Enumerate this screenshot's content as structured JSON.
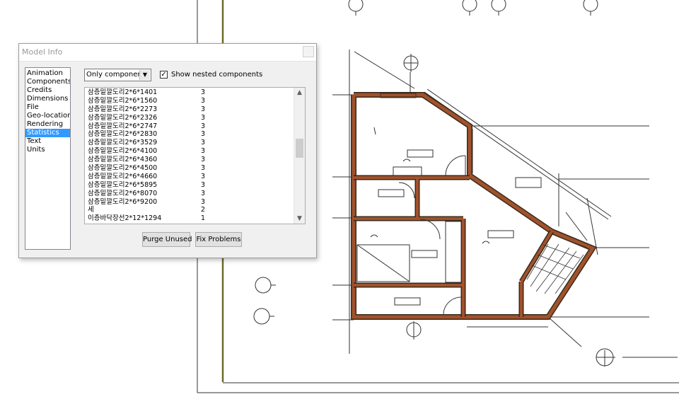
{
  "dialog": {
    "title": "Model Info",
    "close_label": ""
  },
  "categories": [
    {
      "label": "Animation",
      "selected": false
    },
    {
      "label": "Components",
      "selected": false
    },
    {
      "label": "Credits",
      "selected": false
    },
    {
      "label": "Dimensions",
      "selected": false
    },
    {
      "label": "File",
      "selected": false
    },
    {
      "label": "Geo-location",
      "selected": false
    },
    {
      "label": "Rendering",
      "selected": false
    },
    {
      "label": "Statistics",
      "selected": true
    },
    {
      "label": "Text",
      "selected": false
    },
    {
      "label": "Units",
      "selected": false
    }
  ],
  "filter": {
    "value": "Only components",
    "arrow": "▼"
  },
  "nested": {
    "checked": true,
    "check_mark": "✓",
    "label": "Show nested components"
  },
  "stats": [
    {
      "name": "삼층밑깔도리2*6*1401",
      "count": "3"
    },
    {
      "name": "삼층밑깔도리2*6*1560",
      "count": "3"
    },
    {
      "name": "삼층밑깔도리2*6*2273",
      "count": "3"
    },
    {
      "name": "삼층밑깔도리2*6*2326",
      "count": "3"
    },
    {
      "name": "삼층밑깔도리2*6*2747",
      "count": "3"
    },
    {
      "name": "삼층밑깔도리2*6*2830",
      "count": "3"
    },
    {
      "name": "삼층밑깔도리2*6*3529",
      "count": "3"
    },
    {
      "name": "삼층밑깔도리2*6*4100",
      "count": "3"
    },
    {
      "name": "삼층밑깔도리2*6*4360",
      "count": "3"
    },
    {
      "name": "삼층밑깔도리2*6*4500",
      "count": "3"
    },
    {
      "name": "삼층밑깔도리2*6*4660",
      "count": "3"
    },
    {
      "name": "삼층밑깔도리2*6*5895",
      "count": "3"
    },
    {
      "name": "삼층밑깔도리2*6*8070",
      "count": "3"
    },
    {
      "name": "삼층밑깔도리2*6*9200",
      "count": "3"
    },
    {
      "name": "세",
      "count": "2"
    },
    {
      "name": "이층바닥장선2*12*1294",
      "count": "1"
    }
  ],
  "scroll": {
    "up": "▲",
    "down": "▼",
    "position": 0.42
  },
  "buttons": {
    "purge": "Purge Unused",
    "fix": "Fix Problems"
  },
  "colors": {
    "wall_fill": "#a0522d",
    "wall_outline": "#3a2a1a",
    "selection": "#3399ff",
    "axis_line": "#6b6b2a"
  }
}
